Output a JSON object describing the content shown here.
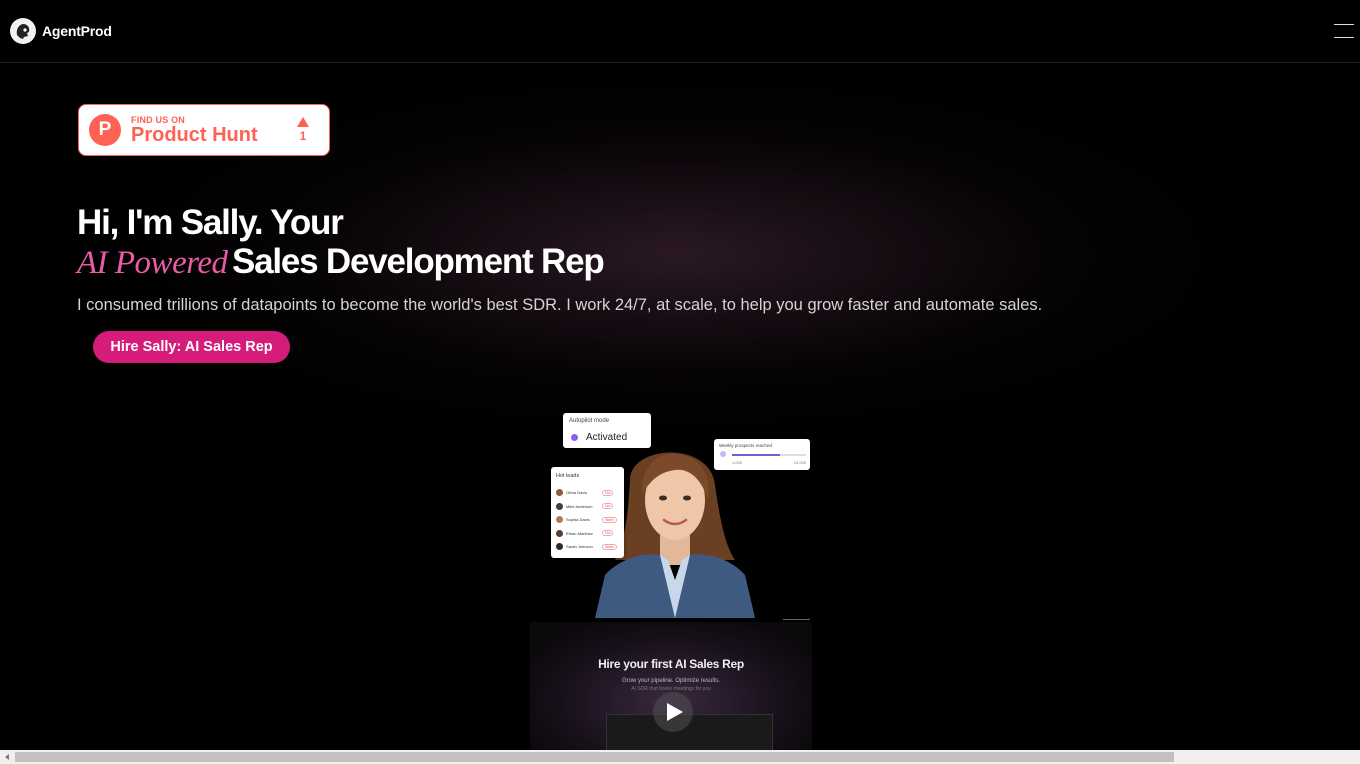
{
  "brand": {
    "name": "AgentProd"
  },
  "product_hunt": {
    "find_us": "FIND US ON",
    "name": "Product Hunt",
    "logo_letter": "P",
    "upvotes": "1"
  },
  "hero": {
    "line1": "Hi, I'm Sally. Your",
    "line2_italic": "AI Powered",
    "line2_bold": "Sales Development Rep",
    "subtitle": "I consumed trillions of datapoints to become the world's best SDR. I work 24/7, at scale, to help you grow faster and automate sales.",
    "cta": "Hire Sally: AI Sales Rep"
  },
  "illustration": {
    "autopilot_label": "Autopilot mode",
    "autopilot_value": "Activated",
    "weekly_label": "Weekly prospects reached",
    "weekly_min": "1,000",
    "weekly_max": "10,000",
    "weekly_progress": 0.65,
    "hot_leads_title": "Hot leads",
    "hot_leads": [
      {
        "name": "Olivia Davis",
        "tag": "Hot"
      },
      {
        "name": "Mike Anderson",
        "tag": "Hot"
      },
      {
        "name": "Sophia Davis",
        "tag": "Warm"
      },
      {
        "name": "Ethan Martinez",
        "tag": "Hot"
      },
      {
        "name": "Sarah Johnson",
        "tag": "Warm"
      }
    ]
  },
  "video": {
    "title": "Hire your first AI Sales Rep",
    "subtitle": "Grow your pipeline. Optimize results.",
    "subtitle2": "AI SDR that books meetings for you"
  },
  "colors": {
    "accent": "#d61c7b",
    "italic_pink": "#e95aa8",
    "product_hunt": "#ff6154",
    "background": "#000000"
  },
  "icons": {
    "logo": "agent-face-logo",
    "menu": "hamburger-icon",
    "play": "play-icon",
    "upvote": "triangle-up-icon"
  }
}
